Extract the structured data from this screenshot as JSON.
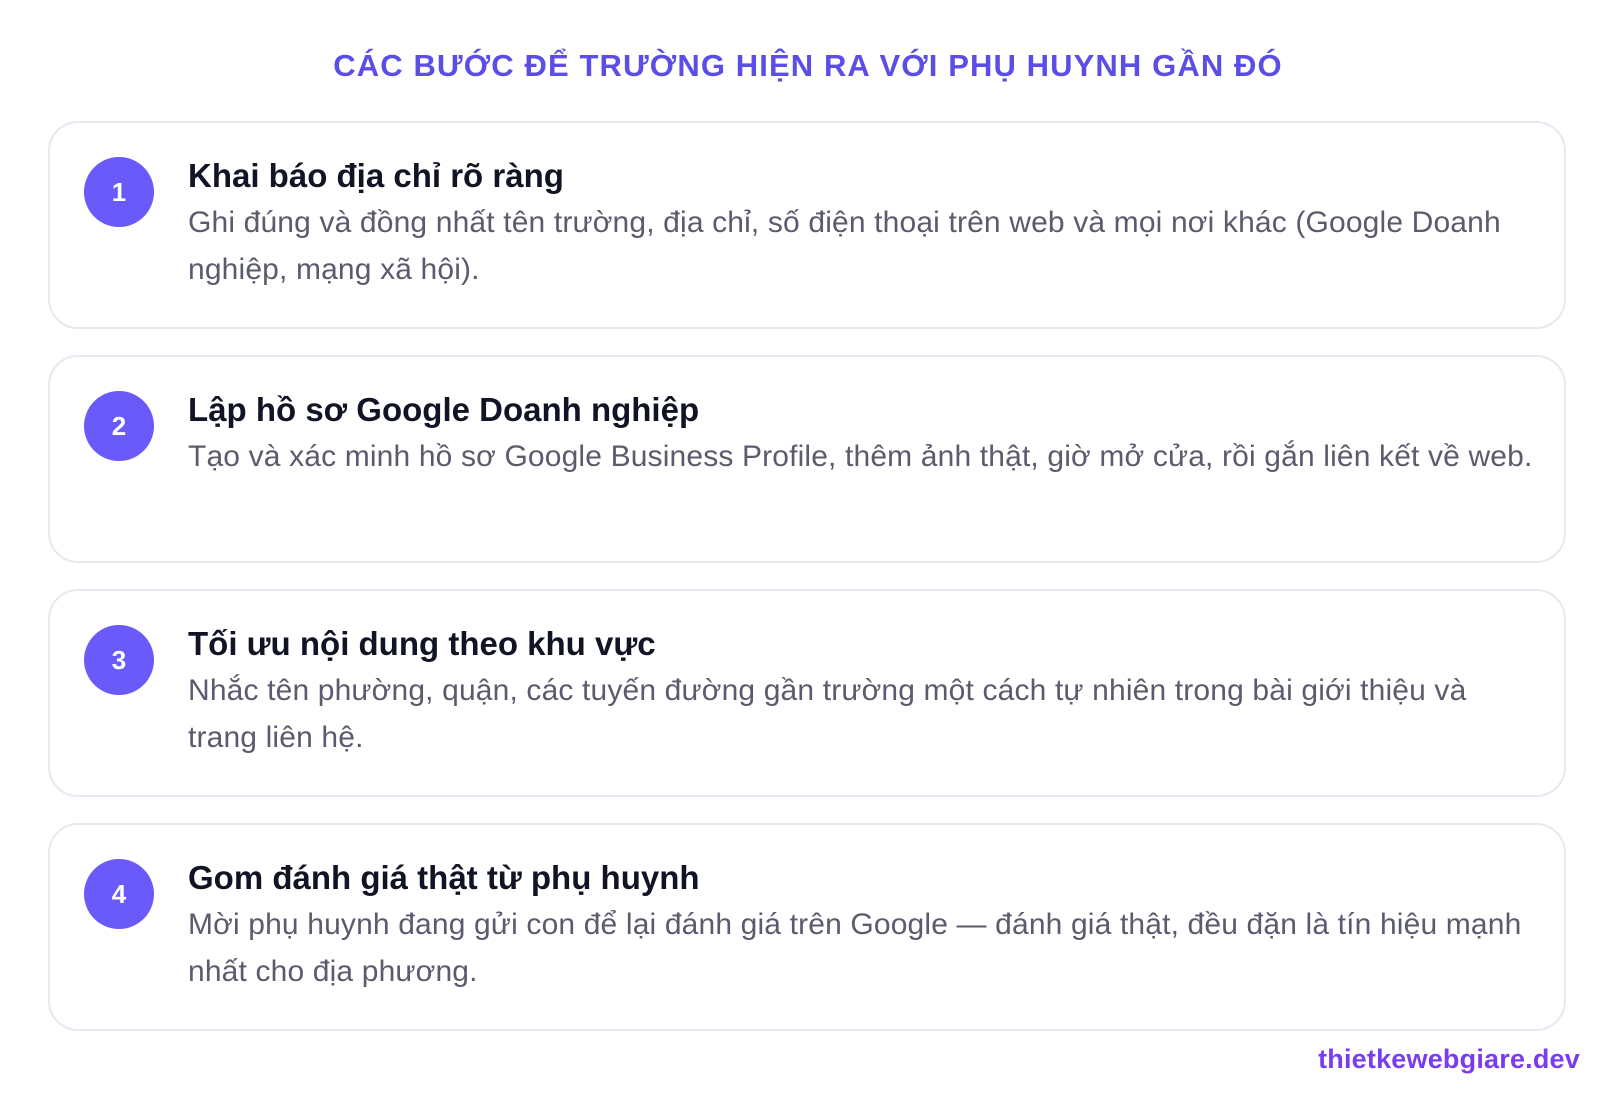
{
  "heading": "CÁC BƯỚC ĐỂ TRƯỜNG HIỆN RA VỚI PHỤ HUYNH GẦN ĐÓ",
  "steps": [
    {
      "number": "1",
      "title": "Khai báo địa chỉ rõ ràng",
      "description": "Ghi đúng và đồng nhất tên trường, địa chỉ, số điện thoại trên web và mọi nơi khác (Google Doanh nghiệp, mạng xã hội)."
    },
    {
      "number": "2",
      "title": "Lập hồ sơ Google Doanh nghiệp",
      "description": "Tạo và xác minh hồ sơ Google Business Profile, thêm ảnh thật, giờ mở cửa, rồi gắn liên kết về web."
    },
    {
      "number": "3",
      "title": "Tối ưu nội dung theo khu vực",
      "description": "Nhắc tên phường, quận, các tuyến đường gần trường một cách tự nhiên trong bài giới thiệu và trang liên hệ."
    },
    {
      "number": "4",
      "title": "Gom đánh giá thật từ phụ huynh",
      "description": "Mời phụ huynh đang gửi con để lại đánh giá trên Google — đánh giá thật, đều đặn là tín hiệu mạnh nhất cho địa phương."
    }
  ],
  "footer": {
    "brand": "thietkewebgiare.dev"
  },
  "colors": {
    "accent": "#6a5af9",
    "title": "#5b4ee6",
    "brand": "#7a3cf0"
  }
}
